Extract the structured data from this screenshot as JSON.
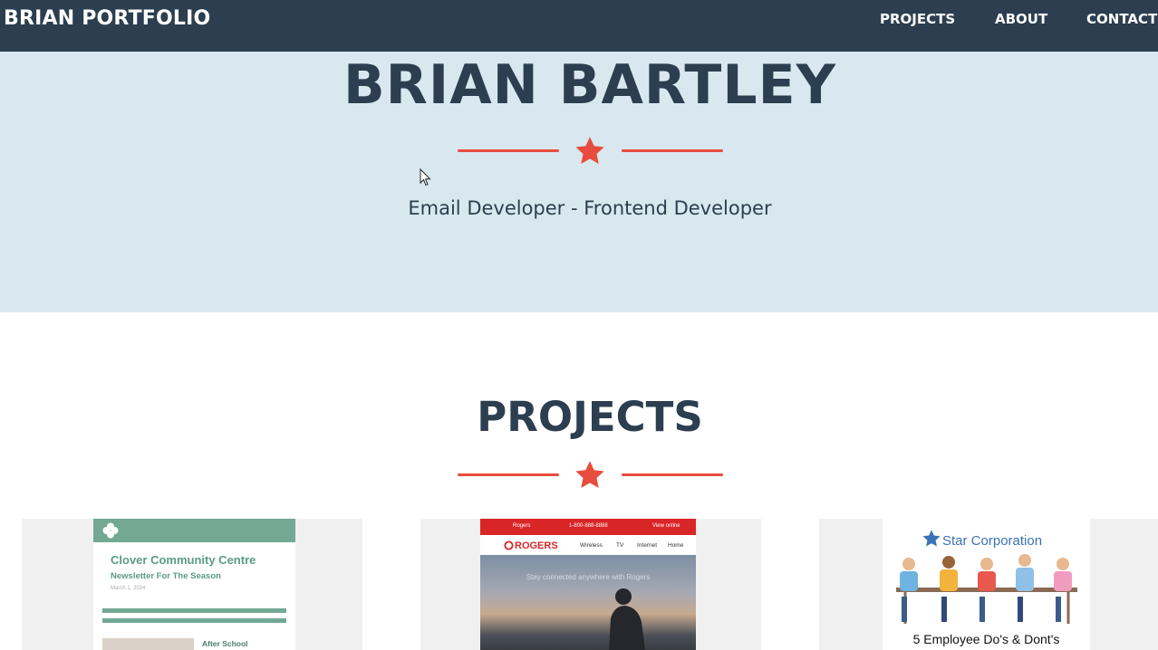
{
  "navbar": {
    "brand": "BRIAN PORTFOLIO",
    "links": [
      {
        "label": "PROJECTS"
      },
      {
        "label": "ABOUT"
      },
      {
        "label": "CONTACT"
      }
    ]
  },
  "hero": {
    "name": "BRIAN BARTLEY",
    "subtitle": "Email Developer - Frontend Developer"
  },
  "projects": {
    "title": "PROJECTS",
    "cards": [
      {
        "title": "Clover Community Centre",
        "subtitle": "Newsletter For The Season",
        "date": "March 1, 2024",
        "article_heading": "After School"
      },
      {
        "top_bar": [
          "Rogers",
          "1-800-888-8888",
          "View online"
        ],
        "logo": "ROGERS",
        "nav": [
          "Wireless",
          "TV",
          "Internet",
          "Home"
        ],
        "headline": "Stay connected anywhere with Rogers"
      },
      {
        "title": "Star Corporation",
        "caption": "5 Employee Do's & Dont's"
      }
    ]
  },
  "colors": {
    "navbar": "#2c3e50",
    "hero_bg": "#d8e8ee",
    "accent": "#e74c3c",
    "text_dark": "#2c3e50"
  },
  "icons": [
    "star-icon",
    "clover-icon",
    "cursor-icon",
    "people-illustration"
  ]
}
